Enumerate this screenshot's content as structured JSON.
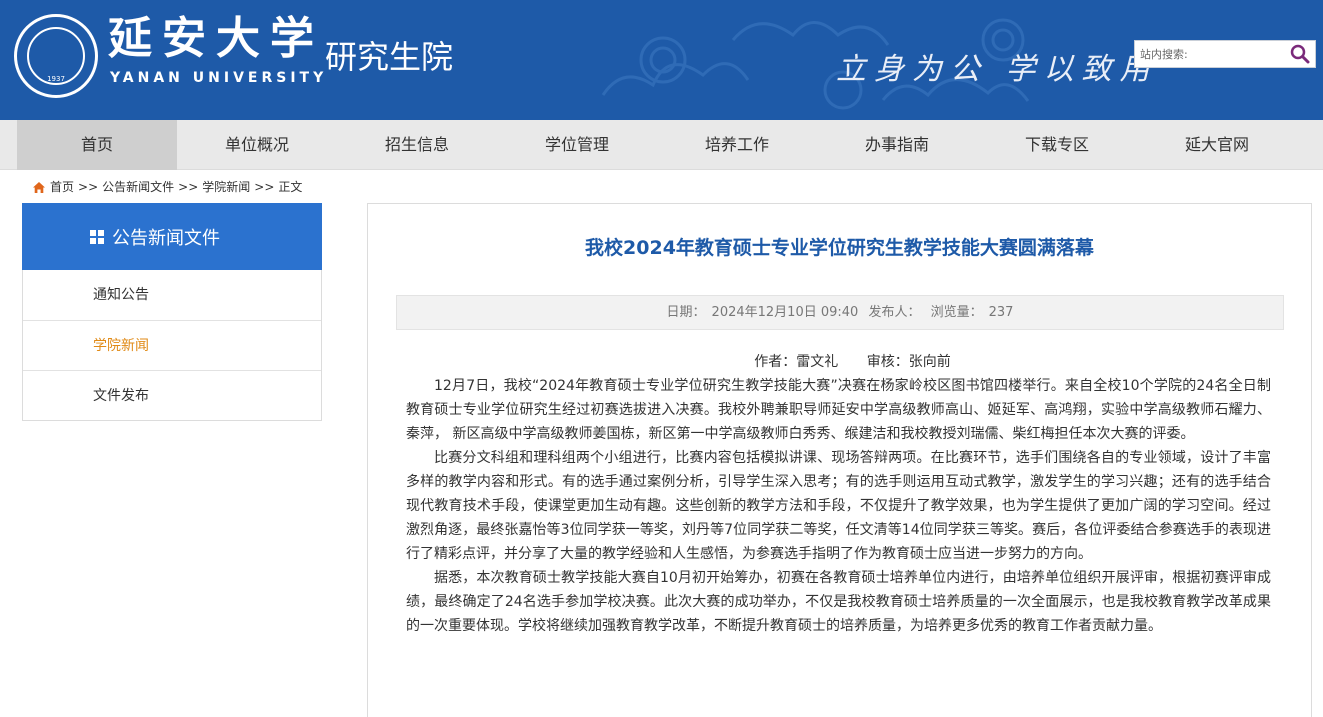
{
  "header": {
    "university_cn": "延安大学",
    "university_en": "YANAN UNIVERSITY",
    "seal_year": "1937",
    "school": "研究生院",
    "slogan": "立身为公  学以致用",
    "search_placeholder": "站内搜索:",
    "brand_color": "#1e5aa8"
  },
  "nav": {
    "items": [
      {
        "label": "首页"
      },
      {
        "label": "单位概况"
      },
      {
        "label": "招生信息"
      },
      {
        "label": "学位管理"
      },
      {
        "label": "培养工作"
      },
      {
        "label": "办事指南"
      },
      {
        "label": "下载专区"
      },
      {
        "label": "延大官网"
      }
    ],
    "active_index": 0
  },
  "breadcrumb": {
    "items": [
      "首页",
      "公告新闻文件",
      "学院新闻",
      "正文"
    ],
    "separator": ">>"
  },
  "sidebar": {
    "title": "公告新闻文件",
    "items": [
      {
        "label": "通知公告"
      },
      {
        "label": "学院新闻"
      },
      {
        "label": "文件发布"
      }
    ],
    "active_index": 1,
    "active_color": "#e08a16"
  },
  "article": {
    "title": "我校2024年教育硕士专业学位研究生教学技能大赛圆满落幕",
    "date_label": "日期：",
    "date": "2024年12月10日 09:40",
    "publisher_label": "发布人：",
    "views_label": "浏览量：",
    "views": "237",
    "author": "作者：雷文礼",
    "reviewer": "审核：张向前",
    "paragraphs": [
      "12月7日，我校“2024年教育硕士专业学位研究生教学技能大赛”决赛在杨家岭校区图书馆四楼举行。来自全校10个学院的24名全日制教育硕士专业学位研究生经过初赛选拔进入决赛。我校外聘兼职导师延安中学高级教师高山、姬延军、高鸿翔，实验中学高级教师石耀力、秦萍， 新区高级中学高级教师姜国栋，新区第一中学高级教师白秀秀、缑建洁和我校教授刘瑞儒、柴红梅担任本次大赛的评委。",
      "比赛分文科组和理科组两个小组进行，比赛内容包括模拟讲课、现场答辩两项。在比赛环节，选手们围绕各自的专业领域，设计了丰富多样的教学内容和形式。有的选手通过案例分析，引导学生深入思考；有的选手则运用互动式教学，激发学生的学习兴趣；还有的选手结合现代教育技术手段，使课堂更加生动有趣。这些创新的教学方法和手段，不仅提升了教学效果，也为学生提供了更加广阔的学习空间。经过激烈角逐，最终张嘉怡等3位同学获一等奖，刘丹等7位同学获二等奖，任文清等14位同学获三等奖。赛后，各位评委结合参赛选手的表现进行了精彩点评，并分享了大量的教学经验和人生感悟，为参赛选手指明了作为教育硕士应当进一步努力的方向。",
      "据悉，本次教育硕士教学技能大赛自10月初开始筹办，初赛在各教育硕士培养单位内进行，由培养单位组织开展评审，根据初赛评审成绩，最终确定了24名选手参加学校决赛。此次大赛的成功举办，不仅是我校教育硕士培养质量的一次全面展示，也是我校教育教学改革成果的一次重要体现。学校将继续加强教育教学改革，不断提升教育硕士的培养质量，为培养更多优秀的教育工作者贡献力量。"
    ]
  }
}
